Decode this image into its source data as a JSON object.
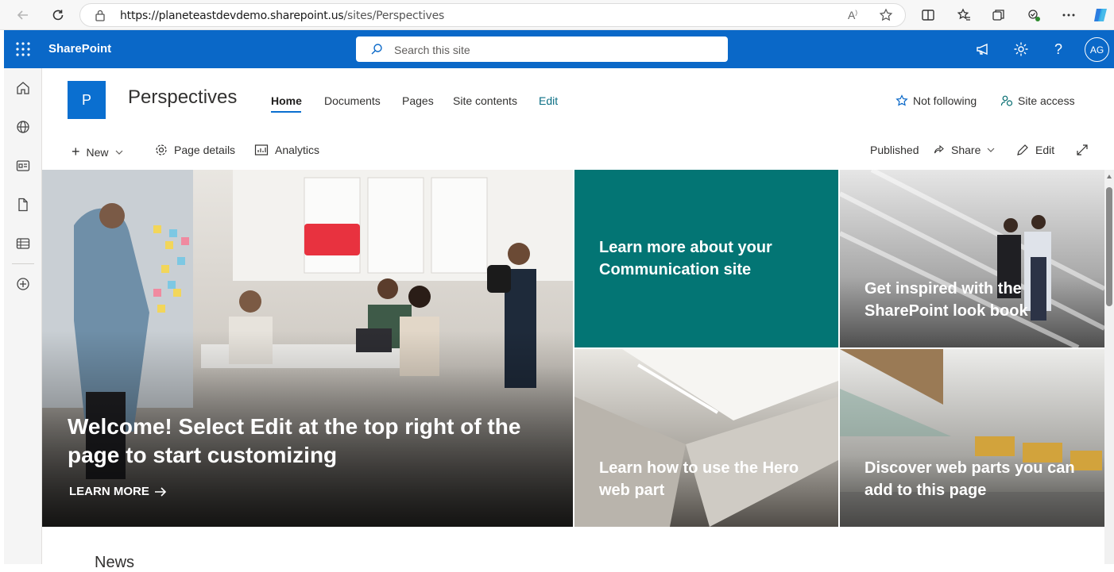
{
  "browser": {
    "url_host": "https://planeteastdevdemo.sharepoint.us",
    "url_path": "/sites/Perspectives"
  },
  "suite": {
    "brand": "SharePoint",
    "search_placeholder": "Search this site",
    "avatar_initials": "AG",
    "accent": "#0a68c8"
  },
  "site": {
    "logo_letter": "P",
    "title": "Perspectives",
    "nav": [
      "Home",
      "Documents",
      "Pages",
      "Site contents",
      "Edit"
    ],
    "follow_label": "Not following",
    "access_label": "Site access"
  },
  "commandbar": {
    "new_label": "New",
    "page_details_label": "Page details",
    "analytics_label": "Analytics",
    "status": "Published",
    "share_label": "Share",
    "edit_label": "Edit"
  },
  "hero": {
    "main_title": "Welcome! Select Edit at the top right of the page to start customizing",
    "main_link": "LEARN MORE",
    "tile_teal": "Learn more about your Communication site",
    "tile_lookbook": "Get inspired with the SharePoint look book",
    "tile_hero": "Learn how to use the Hero web part",
    "tile_webparts": "Discover web parts you can add to this page",
    "teal_color": "#037574"
  },
  "news_heading": "News"
}
